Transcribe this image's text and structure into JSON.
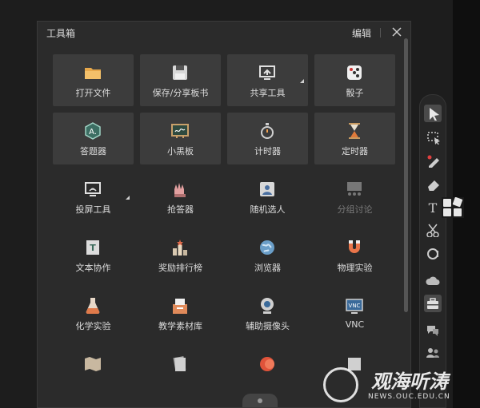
{
  "panel": {
    "title": "工具箱",
    "edit_label": "编辑"
  },
  "tools": [
    {
      "label": "打开文件",
      "icon": "folder-icon",
      "boxed": true
    },
    {
      "label": "保存/分享板书",
      "icon": "floppy-disk-icon",
      "boxed": true
    },
    {
      "label": "共享工具",
      "icon": "share-screen-icon",
      "boxed": true,
      "corner": true
    },
    {
      "label": "骰子",
      "icon": "dice-icon",
      "boxed": true
    },
    {
      "label": "答题器",
      "icon": "answer-device-icon",
      "boxed": true
    },
    {
      "label": "小黑板",
      "icon": "blackboard-icon",
      "boxed": true
    },
    {
      "label": "计时器",
      "icon": "stopwatch-icon",
      "boxed": true
    },
    {
      "label": "定时器",
      "icon": "hourglass-icon",
      "boxed": true
    },
    {
      "label": "投屏工具",
      "icon": "screen-cast-icon",
      "corner": true
    },
    {
      "label": "抢答器",
      "icon": "raise-hands-icon"
    },
    {
      "label": "随机选人",
      "icon": "random-person-icon"
    },
    {
      "label": "分组讨论",
      "icon": "group-discussion-icon",
      "dim": true
    },
    {
      "label": "文本协作",
      "icon": "text-collab-icon"
    },
    {
      "label": "奖励排行榜",
      "icon": "leaderboard-icon"
    },
    {
      "label": "浏览器",
      "icon": "globe-icon"
    },
    {
      "label": "物理实验",
      "icon": "magnet-icon"
    },
    {
      "label": "化学实验",
      "icon": "flask-icon"
    },
    {
      "label": "教学素材库",
      "icon": "material-library-icon"
    },
    {
      "label": "辅助摄像头",
      "icon": "webcam-icon"
    },
    {
      "label": "VNC",
      "icon": "vnc-icon"
    },
    {
      "label": "",
      "icon": "map-icon"
    },
    {
      "label": "",
      "icon": "documents-icon"
    },
    {
      "label": "",
      "icon": "record-icon"
    },
    {
      "label": "",
      "icon": "cube-icon"
    }
  ],
  "toolbar": {
    "items": [
      {
        "icon": "cursor-arrow-icon",
        "active": true
      },
      {
        "icon": "area-select-icon"
      },
      {
        "icon": "pen-icon"
      },
      {
        "icon": "eraser-icon"
      },
      {
        "icon": "text-icon"
      },
      {
        "icon": "scissors-icon"
      },
      {
        "icon": "magnifier-icon"
      },
      {
        "icon": "cloud-icon"
      },
      {
        "icon": "toolbox-icon",
        "active": true
      },
      {
        "icon": "chat-icon"
      },
      {
        "icon": "users-icon"
      }
    ]
  },
  "watermark": {
    "name": "观海听涛",
    "url": "NEWS.OUC.EDU.CN"
  },
  "colors": {
    "background": "#1d1d1d",
    "panel": "#2b2b2b",
    "tile": "#3c3c3c",
    "toolbar": "#262626",
    "text": "#dcdcdc",
    "dim_text": "#7a7a7a"
  }
}
